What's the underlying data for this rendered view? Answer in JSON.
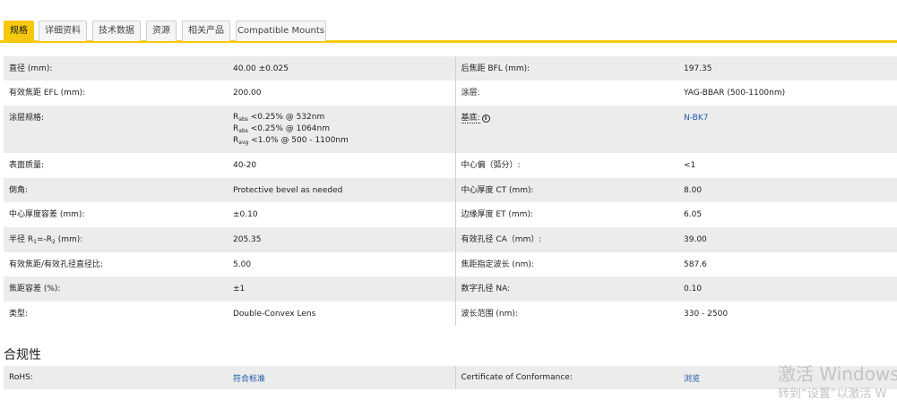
{
  "tabs": [
    "规格",
    "详细资料",
    "技术数据",
    "资源",
    "相关产品",
    "Compatible Mounts"
  ],
  "specs": [
    {
      "l1": "直径 (mm):",
      "v1": "40.00 ±0.025",
      "l2": "后焦距 BFL (mm):",
      "v2": "197.35"
    },
    {
      "l1": "有效焦距 EFL (mm):",
      "v1": "200.00",
      "l2": "涂层:",
      "v2": "YAG-BBAR (500-1100nm)"
    },
    {
      "l1": "涂层规格:",
      "v1_lines": [
        {
          "pre": "R",
          "sub": "abs",
          "post": " <0.25% @ 532nm"
        },
        {
          "pre": "R",
          "sub": "abs",
          "post": " <0.25% @ 1064nm"
        },
        {
          "pre": "R",
          "sub": "avg",
          "post": " <1.0% @ 500 - 1100nm"
        }
      ],
      "l2": "基底:",
      "l2_info": "i",
      "v2": "N-BK7"
    },
    {
      "l1": "表面质量:",
      "v1": "40-20",
      "l2": "中心偏（弧分）:",
      "v2": "<1"
    },
    {
      "l1": "倒角:",
      "v1": "Protective bevel as needed",
      "l2": "中心厚度 CT (mm):",
      "v2": "8.00"
    },
    {
      "l1": "中心厚度容差 (mm):",
      "v1": "±0.10",
      "l2": "边缘厚度 ET (mm):",
      "v2": "6.05"
    },
    {
      "l1_parts": {
        "a": "半径 R",
        "s1": "1",
        "b": "=-R",
        "s2": "2",
        "c": " (mm):"
      },
      "v1": "205.35",
      "l2": "有效孔径 CA（mm）:",
      "v2": "39.00"
    },
    {
      "l1": "有效焦距/有效孔径直径比:",
      "v1": "5.00",
      "l2": "焦距指定波长 (nm):",
      "v2": "587.6"
    },
    {
      "l1": "焦距容差 (%):",
      "v1": "±1",
      "l2": "数字孔径 NA:",
      "v2": "0.10"
    },
    {
      "l1": "类型:",
      "v1": "Double-Convex Lens",
      "l2": "波长范围 (nm):",
      "v2": "330 - 2500"
    }
  ],
  "compliance": {
    "title": "合规性",
    "l1": "RoHS:",
    "v1": "符合标准",
    "l2": "Certificate of Conformance:",
    "v2": "浏览"
  },
  "watermark": {
    "line1": "激活 Windows",
    "line2": "转到“设置”以激活 W"
  },
  "colors": {
    "accent": "#f6c90e",
    "link": "#1d5aa8",
    "row_shade": "#ececec"
  }
}
